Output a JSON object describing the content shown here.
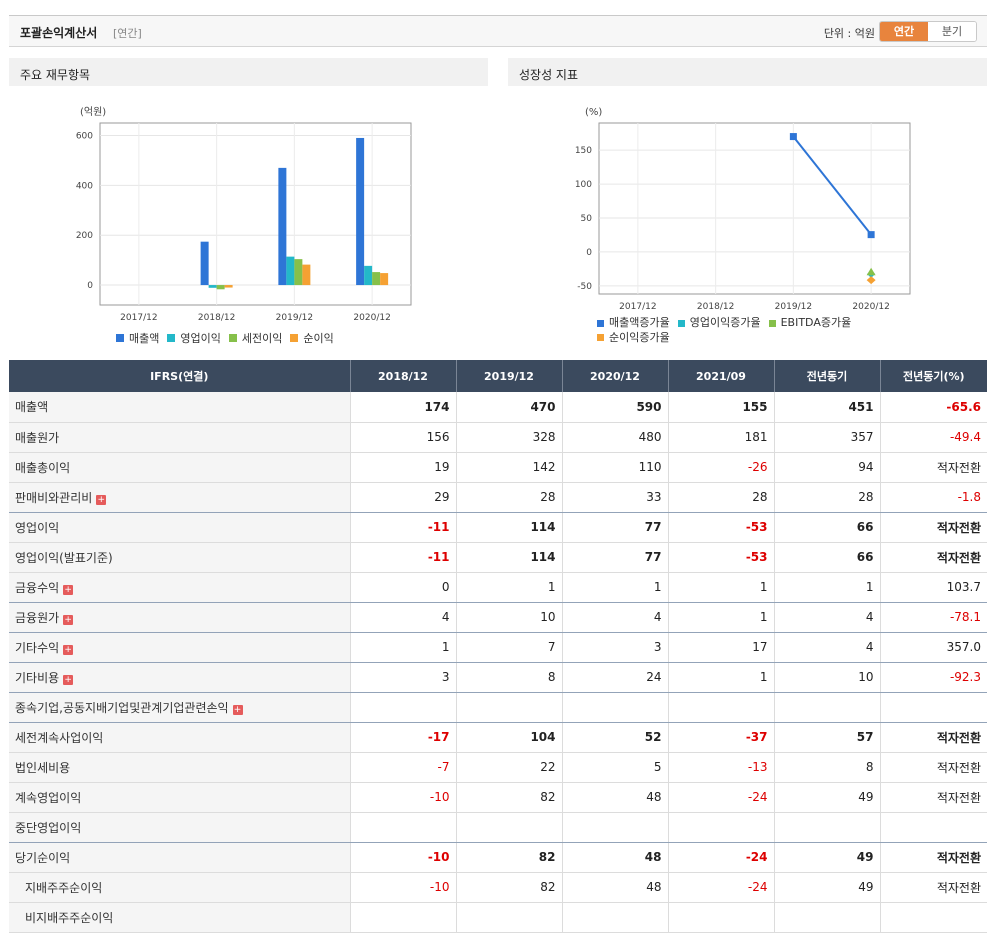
{
  "header": {
    "title": "포괄손익계산서",
    "period_tag": "[연간]",
    "unit": "단위 : 억원",
    "toggle": [
      "연간",
      "분기"
    ]
  },
  "left_panel": {
    "title": "주요 재무항목"
  },
  "right_panel": {
    "title": "성장성 지표"
  },
  "chart_data": [
    {
      "type": "bar",
      "ylabel": "(억원)",
      "categories": [
        "2017/12",
        "2018/12",
        "2019/12",
        "2020/12"
      ],
      "ylim": [
        -80,
        650
      ],
      "yticks": [
        600,
        400,
        200,
        0
      ],
      "series": [
        {
          "name": "매출액",
          "color": "#2e75d6",
          "values": [
            null,
            174,
            470,
            590
          ]
        },
        {
          "name": "영업이익",
          "color": "#23b8c9",
          "values": [
            null,
            -11,
            114,
            77
          ]
        },
        {
          "name": "세전이익",
          "color": "#86c04a",
          "values": [
            null,
            -17,
            104,
            52
          ]
        },
        {
          "name": "순이익",
          "color": "#f5a133",
          "values": [
            null,
            -10,
            82,
            48
          ]
        }
      ],
      "legend": "bottom"
    },
    {
      "type": "line",
      "ylabel": "(%)",
      "categories": [
        "2017/12",
        "2018/12",
        "2019/12",
        "2020/12"
      ],
      "ylim": [
        -62,
        190
      ],
      "yticks": [
        150,
        100,
        50,
        0,
        -50
      ],
      "series": [
        {
          "name": "매출액증가율",
          "color": "#2e75d6",
          "values": [
            null,
            null,
            170,
            25.5
          ]
        },
        {
          "name": "영업이익증가율",
          "color": "#23b8c9",
          "values": [
            null,
            null,
            null,
            -32.5
          ]
        },
        {
          "name": "EBITDA증가율",
          "color": "#86c04a",
          "values": [
            null,
            null,
            null,
            -30
          ]
        },
        {
          "name": "순이익증가율",
          "color": "#f5a133",
          "values": [
            null,
            null,
            null,
            -41.5
          ]
        }
      ],
      "legend": "bottom"
    }
  ],
  "table": {
    "columns": [
      "IFRS(연결)",
      "2018/12",
      "2019/12",
      "2020/12",
      "2021/09",
      "전년동기",
      "전년동기(%)"
    ],
    "rows": [
      {
        "label": "매출액",
        "values": [
          "174",
          "470",
          "590",
          "155",
          "451",
          "-65.6"
        ],
        "bold": true
      },
      {
        "label": "매출원가",
        "values": [
          "156",
          "328",
          "480",
          "181",
          "357",
          "-49.4"
        ]
      },
      {
        "label": "매출총이익",
        "values": [
          "19",
          "142",
          "110",
          "-26",
          "94",
          "적자전환"
        ]
      },
      {
        "label": "판매비와관리비",
        "values": [
          "29",
          "28",
          "33",
          "28",
          "28",
          "-1.8"
        ],
        "expand": true,
        "line": true
      },
      {
        "label": "영업이익",
        "values": [
          "-11",
          "114",
          "77",
          "-53",
          "66",
          "적자전환"
        ],
        "bold": true
      },
      {
        "label": "영업이익(발표기준)",
        "values": [
          "-11",
          "114",
          "77",
          "-53",
          "66",
          "적자전환"
        ],
        "bold": true
      },
      {
        "label": "금융수익",
        "values": [
          "0",
          "1",
          "1",
          "1",
          "1",
          "103.7"
        ],
        "expand": true,
        "line": true
      },
      {
        "label": "금융원가",
        "values": [
          "4",
          "10",
          "4",
          "1",
          "4",
          "-78.1"
        ],
        "expand": true,
        "line": true
      },
      {
        "label": "기타수익",
        "values": [
          "1",
          "7",
          "3",
          "17",
          "4",
          "357.0"
        ],
        "expand": true,
        "line": true
      },
      {
        "label": "기타비용",
        "values": [
          "3",
          "8",
          "24",
          "1",
          "10",
          "-92.3"
        ],
        "expand": true,
        "line": true
      },
      {
        "label": "종속기업,공동지배기업및관계기업관련손익",
        "values": [
          "",
          "",
          "",
          "",
          "",
          ""
        ],
        "expand": true,
        "line": true
      },
      {
        "label": "세전계속사업이익",
        "values": [
          "-17",
          "104",
          "52",
          "-37",
          "57",
          "적자전환"
        ],
        "bold": true
      },
      {
        "label": "법인세비용",
        "values": [
          "-7",
          "22",
          "5",
          "-13",
          "8",
          "적자전환"
        ]
      },
      {
        "label": "계속영업이익",
        "values": [
          "-10",
          "82",
          "48",
          "-24",
          "49",
          "적자전환"
        ]
      },
      {
        "label": "중단영업이익",
        "values": [
          "",
          "",
          "",
          "",
          "",
          ""
        ],
        "line": true
      },
      {
        "label": "당기순이익",
        "values": [
          "-10",
          "82",
          "48",
          "-24",
          "49",
          "적자전환"
        ],
        "bold": true
      },
      {
        "label": "지배주주순이익",
        "values": [
          "-10",
          "82",
          "48",
          "-24",
          "49",
          "적자전환"
        ],
        "indent": true
      },
      {
        "label": "비지배주주순이익",
        "values": [
          "",
          "",
          "",
          "",
          "",
          ""
        ],
        "indent": true
      }
    ]
  }
}
